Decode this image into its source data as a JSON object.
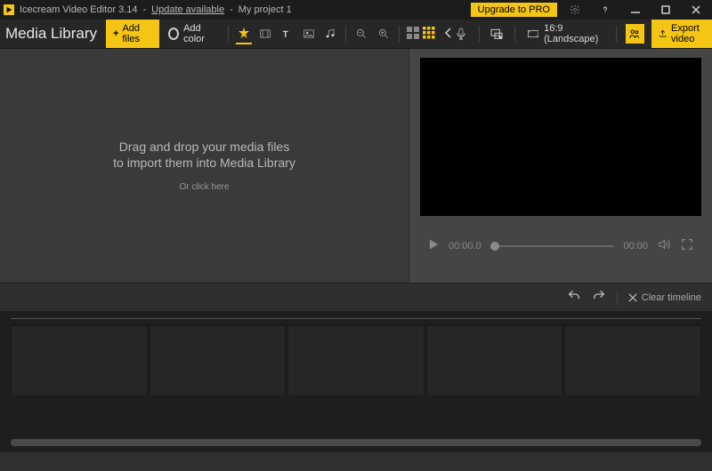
{
  "titlebar": {
    "app_name": "Icecream Video Editor 3.14",
    "update_label": "Update available",
    "project_name": "My project 1",
    "separator": "-",
    "upgrade_label": "Upgrade to PRO"
  },
  "toolbar": {
    "library_title": "Media Library",
    "add_files_label": "Add files",
    "add_color_label": "Add color",
    "aspect_label": "16:9 (Landscape)",
    "export_label": "Export video"
  },
  "media_drop": {
    "line1": "Drag and drop your media files",
    "line2": "to import them into Media Library",
    "line3": "Or click here"
  },
  "player": {
    "current_time": "00:00.0",
    "duration": "00:00"
  },
  "timeline_header": {
    "clear_label": "Clear timeline"
  },
  "timeline": {
    "slot_count": 5
  },
  "colors": {
    "accent": "#f4c514",
    "bg_dark": "#1c1c1c"
  }
}
